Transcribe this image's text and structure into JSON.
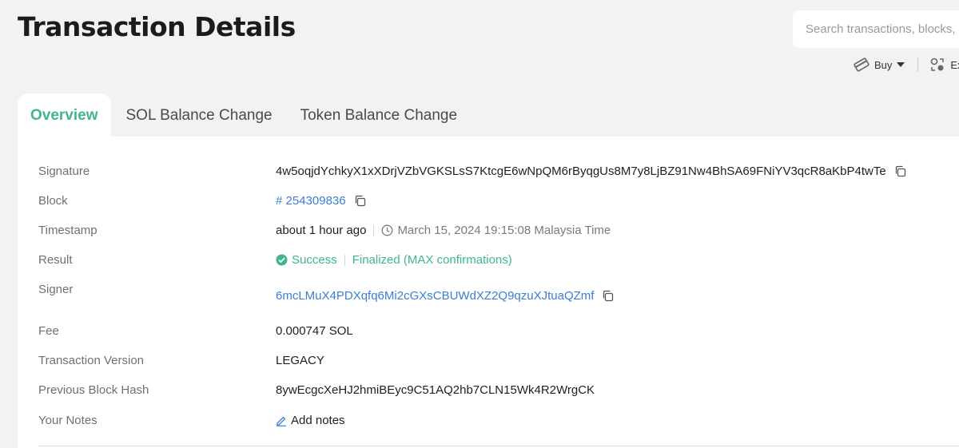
{
  "header": {
    "title": "Transaction Details",
    "search_placeholder": "Search transactions, blocks, programs and tokens",
    "actions": [
      {
        "label": "Buy",
        "icon": "card-icon"
      },
      {
        "label": "Exchange",
        "icon": "exchange-icon"
      }
    ]
  },
  "tabs": [
    {
      "label": "Overview",
      "active": true
    },
    {
      "label": "SOL Balance Change",
      "active": false
    },
    {
      "label": "Token Balance Change",
      "active": false
    }
  ],
  "details": {
    "signature": {
      "label": "Signature",
      "value": "4w5oqjdYchkyX1xXDrjVZbVGKSLsS7KtcgE6wNpQM6rByqgUs8M7y8LjBZ91Nw4BhSA69FNiYV3qcR8aKbP4twTe"
    },
    "block": {
      "label": "Block",
      "value": "# 254309836"
    },
    "timestamp": {
      "label": "Timestamp",
      "relative": "about 1 hour ago",
      "absolute": "March 15, 2024 19:15:08 Malaysia Time"
    },
    "result": {
      "label": "Result",
      "status": "Success",
      "confirmation": "Finalized (MAX confirmations)"
    },
    "signer": {
      "label": "Signer",
      "value": "6mcLMuX4PDXqfq6Mi2cGXsCBUWdXZ2Q9qzuXJtuaQZmf"
    },
    "fee": {
      "label": "Fee",
      "value": "0.000747 SOL"
    },
    "version": {
      "label": "Transaction Version",
      "value": "LEGACY"
    },
    "prev_hash": {
      "label": "Previous Block Hash",
      "value": "8ywEcgcXeHJ2hmiBEyc9C51AQ2hb7CLN15Wk4R2WrgCK"
    },
    "notes": {
      "label": "Your Notes",
      "action": "Add notes"
    }
  },
  "colors": {
    "accent_green": "#3fb68b",
    "link_blue": "#3a7fd6",
    "background": "#f2f2f2",
    "panel": "#ffffff"
  }
}
